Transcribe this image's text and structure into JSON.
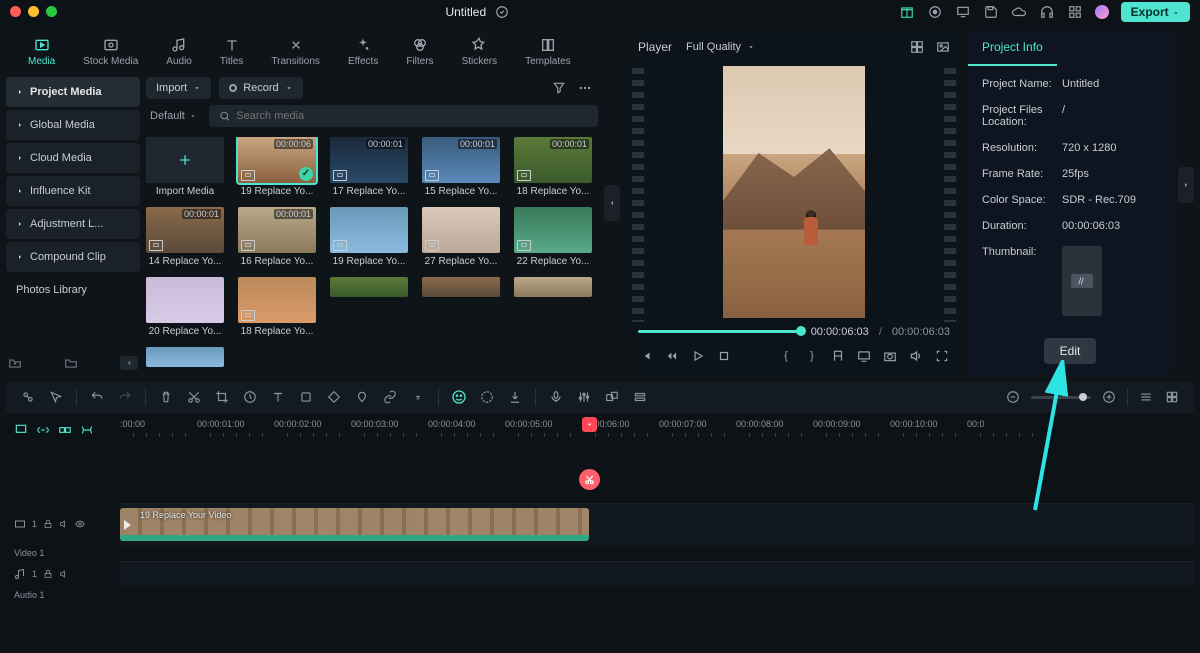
{
  "title": "Untitled",
  "export_btn": "Export",
  "nav_tabs": [
    "Media",
    "Stock Media",
    "Audio",
    "Titles",
    "Transitions",
    "Effects",
    "Filters",
    "Stickers",
    "Templates"
  ],
  "sidebar": {
    "items": [
      "Project Media",
      "Global Media",
      "Cloud Media",
      "Influence Kit",
      "Adjustment L...",
      "Compound Clip",
      "Photos Library"
    ],
    "active": 0
  },
  "import": "Import",
  "record": "Record",
  "default": "Default",
  "search_placeholder": "Search media",
  "import_media": "Import Media",
  "media": [
    {
      "label": "19 Replace Yo...",
      "dur": "00:00:06",
      "sel": true,
      "chk": true
    },
    {
      "label": "17 Replace Yo...",
      "dur": "00:00:01"
    },
    {
      "label": "15 Replace Yo...",
      "dur": "00:00:01"
    },
    {
      "label": "18 Replace Yo...",
      "dur": "00:00:01"
    },
    {
      "label": "14 Replace Yo...",
      "dur": "00:00:01"
    },
    {
      "label": "16 Replace Yo...",
      "dur": "00:00:01"
    },
    {
      "label": "19 Replace Yo...",
      "dur": ""
    },
    {
      "label": "27 Replace Yo...",
      "dur": ""
    },
    {
      "label": "22 Replace Yo...",
      "dur": ""
    },
    {
      "label": "20 Replace Yo...",
      "dur": ""
    },
    {
      "label": "18 Replace Yo...",
      "dur": ""
    }
  ],
  "player": {
    "label": "Player",
    "quality": "Full Quality",
    "time_current": "00:00:06:03",
    "time_total": "00:00:06:03"
  },
  "project_info": {
    "tab": "Project Info",
    "labels": {
      "name": "Project Name:",
      "loc": "Project Files Location:",
      "res": "Resolution:",
      "fps": "Frame Rate:",
      "cs": "Color Space:",
      "dur": "Duration:",
      "thumb": "Thumbnail:"
    },
    "name": "Untitled",
    "location": "/",
    "resolution": "720 x 1280",
    "frame_rate": "25fps",
    "color_space": "SDR - Rec.709",
    "duration": "00:00:06:03",
    "edit": "Edit"
  },
  "timeline": {
    "marks": [
      ":00:00",
      "00:00:01:00",
      "00:00:02:00",
      "00:00:03:00",
      "00:00:04:00",
      "00:00:05:00",
      "00:00:06:00",
      "00:00:07:00",
      "00:00:08:00",
      "00:00:09:00",
      "00:00:10:00",
      "00:0"
    ],
    "clip_label": "19 Replace Your Video",
    "video_track": "Video 1",
    "audio_track": "Audio 1"
  }
}
